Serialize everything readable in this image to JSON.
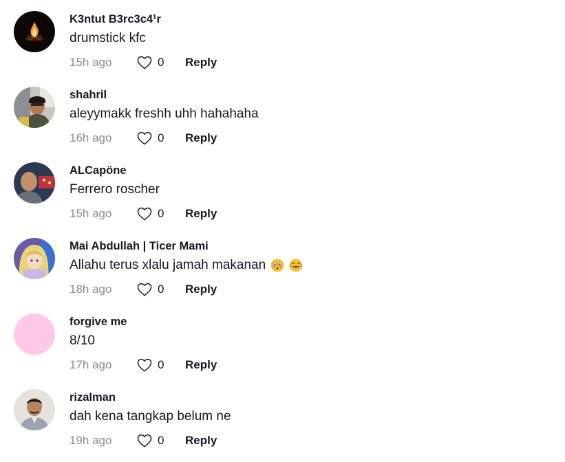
{
  "comments": [
    {
      "username": "K3ntut B3rc3c4¹r",
      "text": "drumstick kfc",
      "timestamp": "15h ago",
      "likes": "0",
      "reply_label": "Reply",
      "avatar": "campfire-avatar",
      "emojis": []
    },
    {
      "username": "shahril",
      "text": "aleyymakk freshh uhh hahahaha",
      "timestamp": "16h ago",
      "likes": "0",
      "reply_label": "Reply",
      "avatar": "man-photo-avatar",
      "emojis": []
    },
    {
      "username": "ALCapöne",
      "text": "Ferrero roscher",
      "timestamp": "15h ago",
      "likes": "0",
      "reply_label": "Reply",
      "avatar": "man-night-street-avatar",
      "emojis": []
    },
    {
      "username": "Mai Abdullah | Ticer Mami",
      "text": "Allahu terus xlalu jamah makanan",
      "timestamp": "18h ago",
      "likes": "0",
      "reply_label": "Reply",
      "avatar": "anime-girl-avatar",
      "emojis": [
        "flushed-face-emoji",
        "tears-of-joy-emoji"
      ]
    },
    {
      "username": "forgive me",
      "text": "8/10",
      "timestamp": "17h ago",
      "likes": "0",
      "reply_label": "Reply",
      "avatar": "pink-blank-avatar",
      "emojis": []
    },
    {
      "username": "rizalman",
      "text": "dah kena tangkap belum ne",
      "timestamp": "19h ago",
      "likes": "0",
      "reply_label": "Reply",
      "avatar": "man-portrait-avatar",
      "emojis": []
    }
  ],
  "colors": {
    "text": "#161823",
    "muted": "#8a8b91",
    "heart_stroke": "#161823"
  }
}
